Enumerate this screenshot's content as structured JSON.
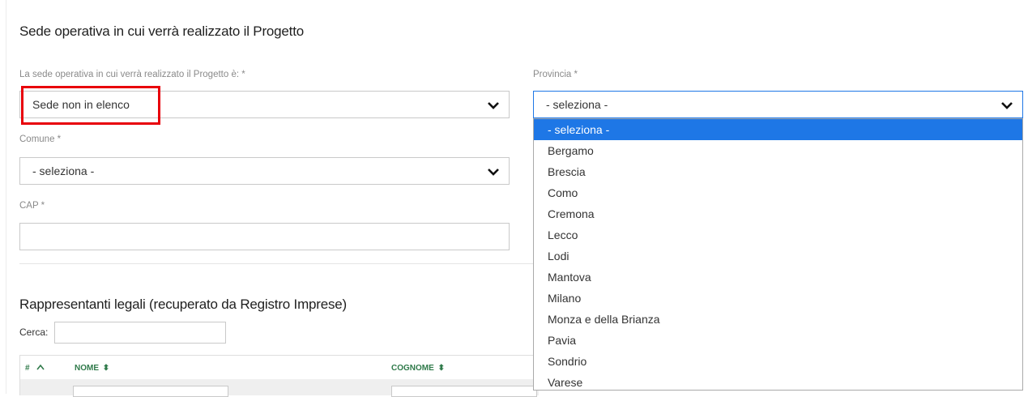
{
  "section": {
    "title": "Sede operativa in cui verrà realizzato il Progetto"
  },
  "sede": {
    "label": "La sede operativa in cui verrà realizzato il Progetto è: *",
    "value": "Sede non in elenco"
  },
  "provincia": {
    "label": "Provincia *",
    "value": "- seleziona -",
    "options": [
      "- seleziona -",
      "Bergamo",
      "Brescia",
      "Como",
      "Cremona",
      "Lecco",
      "Lodi",
      "Mantova",
      "Milano",
      "Monza e della Brianza",
      "Pavia",
      "Sondrio",
      "Varese"
    ],
    "selected_index": 0
  },
  "comune": {
    "label": "Comune *",
    "value": "- seleziona -"
  },
  "cap": {
    "label": "CAP *",
    "value": ""
  },
  "rappresentanti": {
    "title": "Rappresentanti legali (recuperato da Registro Imprese)",
    "search_label": "Cerca:",
    "columns": [
      "#",
      "NOME",
      "COGNOME"
    ]
  },
  "colors": {
    "highlight": "#e8000a",
    "selected_option": "#1e77e6",
    "column_header": "#2f7a4a"
  },
  "icons": {
    "select_arrow": "chevron-down-icon",
    "sort_asc": "caret-up-icon",
    "sort_both": "sort-icon"
  }
}
